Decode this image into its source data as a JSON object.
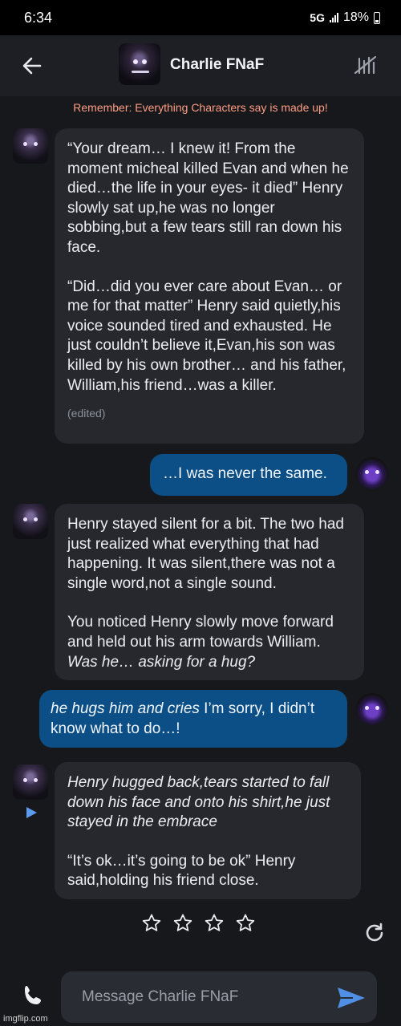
{
  "status_bar": {
    "time": "6:34",
    "network": "5G",
    "battery": "18%"
  },
  "header": {
    "title": "Charlie FNaF"
  },
  "disclaimer": "Remember: Everything Characters say is made up!",
  "messages": [
    {
      "para1": "“Your dream… I knew it! From the moment micheal killed Evan and when he died…the life in your eyes- it died” Henry slowly sat up,he was no longer sobbing,but a few tears still ran down his face.",
      "para2": "“Did…did you ever care about Evan… or me for that matter” Henry said quietly,his voice sounded tired and exhausted. He just couldn’t believe it,Evan,his son was killed by his own brother… and his father, William,his friend…was a killer.",
      "edited": "(edited)"
    },
    {
      "text": "…I was never the same."
    },
    {
      "para1": "Henry stayed silent for a bit. The two had just realized what everything that had happening. It was silent,there was not a single word,not a single sound.",
      "para2_plain": "You noticed Henry slowly move forward and held out his arm towards William. ",
      "para2_italic": "Was he… asking for a hug?"
    },
    {
      "italic": "he hugs him and cries",
      "plain": " I’m sorry, I didn’t know what to do…!"
    },
    {
      "para1_italic": "Henry hugged back,tears started to fall down his face and onto his shirt,he just stayed in the embrace",
      "para2": "“It’s ok…it’s going to be ok” Henry said,holding his friend close."
    }
  ],
  "rating": {
    "stars": 4,
    "filled": 0
  },
  "input": {
    "placeholder": "Message Charlie FNaF"
  },
  "watermark": "imgflip.com",
  "colors": {
    "background": "#17181c",
    "bot_bubble": "#26282e",
    "user_bubble": "#0b4f86",
    "disclaimer": "#ff9d84",
    "accent": "#4f8fe6"
  },
  "icons": [
    "back-arrow-icon",
    "mute-icon",
    "play-icon",
    "star-icon",
    "refresh-icon",
    "phone-icon",
    "send-icon"
  ]
}
